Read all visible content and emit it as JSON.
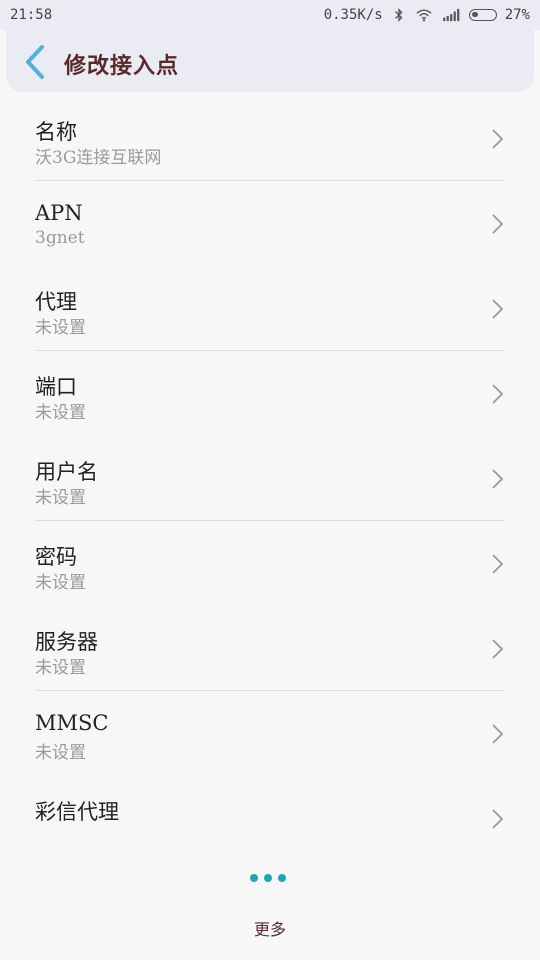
{
  "status_bar": {
    "time": "21:58",
    "speed": "0.35K/s",
    "battery_text": "27%",
    "battery_level": 0.27,
    "icons": [
      "bluetooth-icon",
      "wifi-icon",
      "signal-icon",
      "battery-icon"
    ]
  },
  "header": {
    "title": "修改接入点",
    "back_icon": "chevron-left-icon",
    "accent_color": "#4fb3d9"
  },
  "items": [
    {
      "title": "名称",
      "value": "沃3G连接互联网"
    },
    {
      "title": "APN",
      "value": "3gnet"
    },
    {
      "title": "代理",
      "value": "未设置"
    },
    {
      "title": "端口",
      "value": "未设置"
    },
    {
      "title": "用户名",
      "value": "未设置"
    },
    {
      "title": "密码",
      "value": "未设置"
    },
    {
      "title": "服务器",
      "value": "未设置"
    },
    {
      "title": "MMSC",
      "value": "未设置"
    },
    {
      "title": "彩信代理",
      "value": ""
    }
  ],
  "footer": {
    "more_label": "更多",
    "more_icon": "more-dots-icon",
    "dot_color": "#1ea6b5"
  }
}
